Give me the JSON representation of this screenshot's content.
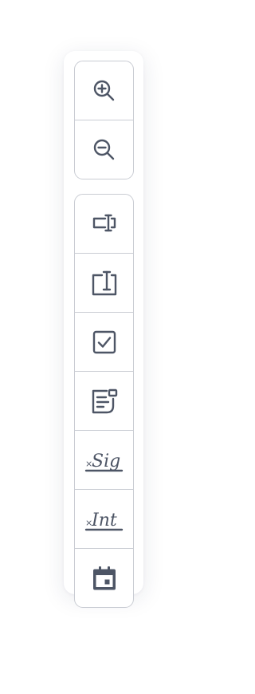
{
  "toolbar": {
    "zoom_tools": [
      {
        "icon": "zoom-in-icon"
      },
      {
        "icon": "zoom-out-icon"
      }
    ],
    "field_tools": [
      {
        "icon": "text-field-icon"
      },
      {
        "icon": "text-area-icon"
      },
      {
        "icon": "checkbox-icon"
      },
      {
        "icon": "form-field-icon"
      },
      {
        "icon": "signature-icon",
        "glyph_text": "Sig",
        "prefix": "×"
      },
      {
        "icon": "initials-icon",
        "glyph_text": "Int",
        "prefix": "×"
      },
      {
        "icon": "calendar-icon"
      }
    ],
    "icon_color": "#4d5565",
    "border_color": "#c9ccd3"
  }
}
